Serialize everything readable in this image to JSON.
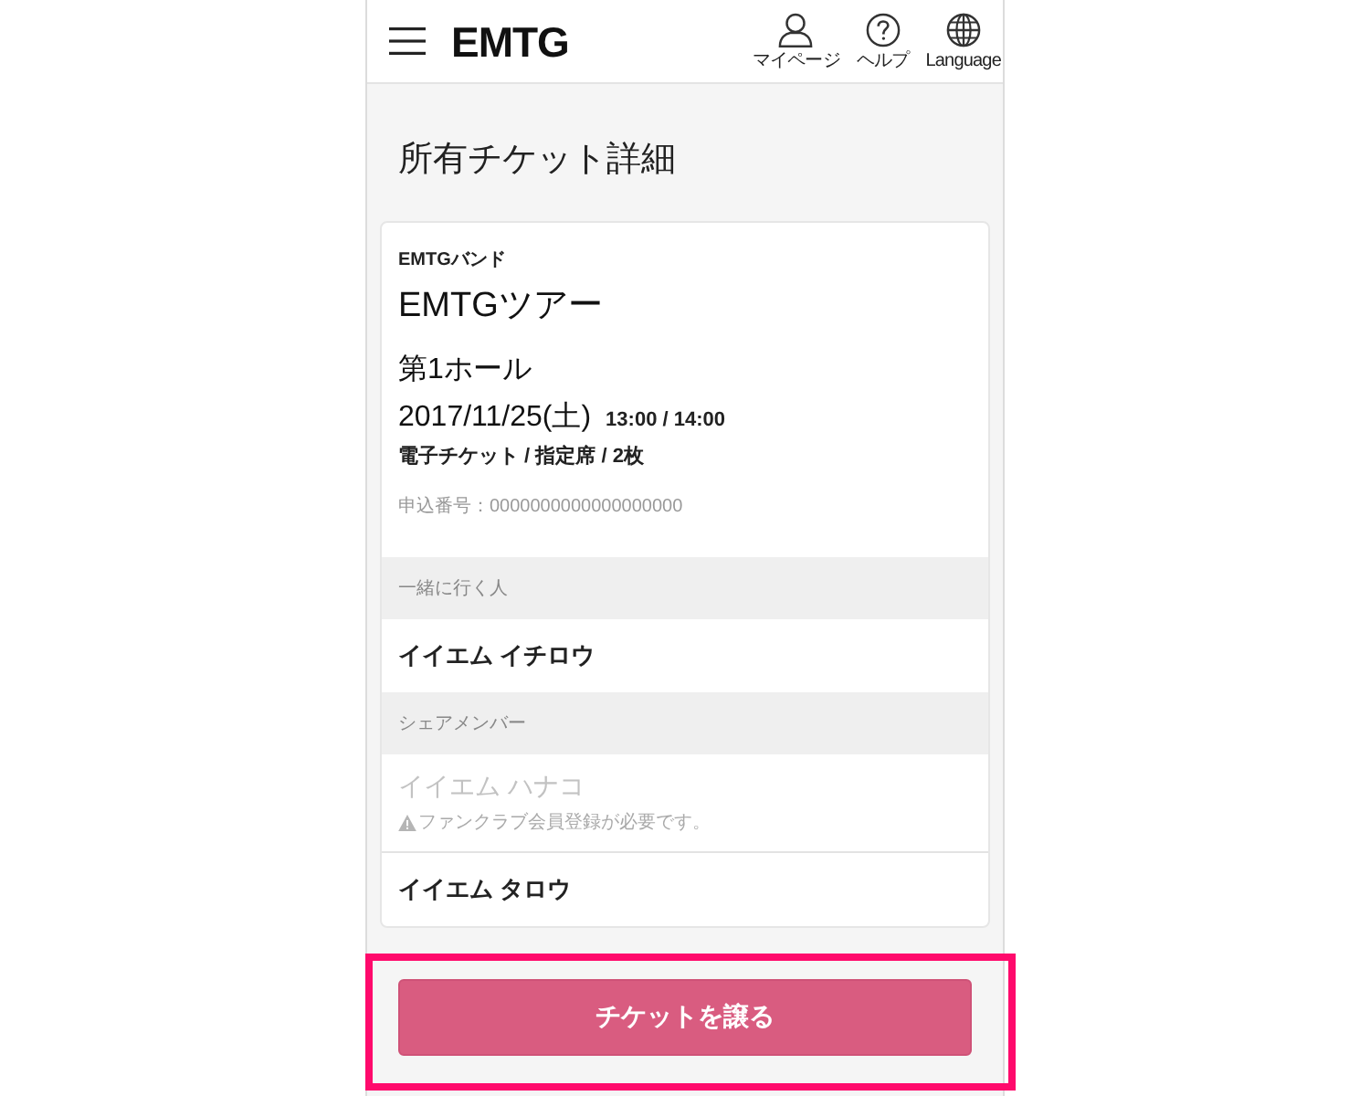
{
  "header": {
    "logo": "EMTG",
    "nav": [
      {
        "kind": "user",
        "label": "マイページ"
      },
      {
        "kind": "help",
        "label": "ヘルプ"
      },
      {
        "kind": "globe",
        "label": "Language"
      }
    ]
  },
  "page_title": "所有チケット詳細",
  "ticket": {
    "artist": "EMTGバンド",
    "tour": "EMTGツアー",
    "venue": "第1ホール",
    "date": "2017/11/25(土)",
    "time": "13:00 / 14:00",
    "details": "電子チケット / 指定席 / 2枚",
    "application_number": "申込番号：0000000000000000000"
  },
  "sections": [
    {
      "heading": "一緒に行く人",
      "members": [
        {
          "name": "イイエム イチロウ",
          "disabled": false
        }
      ]
    },
    {
      "heading": "シェアメンバー",
      "members": [
        {
          "name": "イイエム ハナコ",
          "disabled": true,
          "note": "ファンクラブ会員登録が必要です。"
        },
        {
          "name": "イイエム タロウ",
          "disabled": false
        }
      ]
    }
  ],
  "action": {
    "label": "チケットを譲る",
    "highlighted": true
  }
}
